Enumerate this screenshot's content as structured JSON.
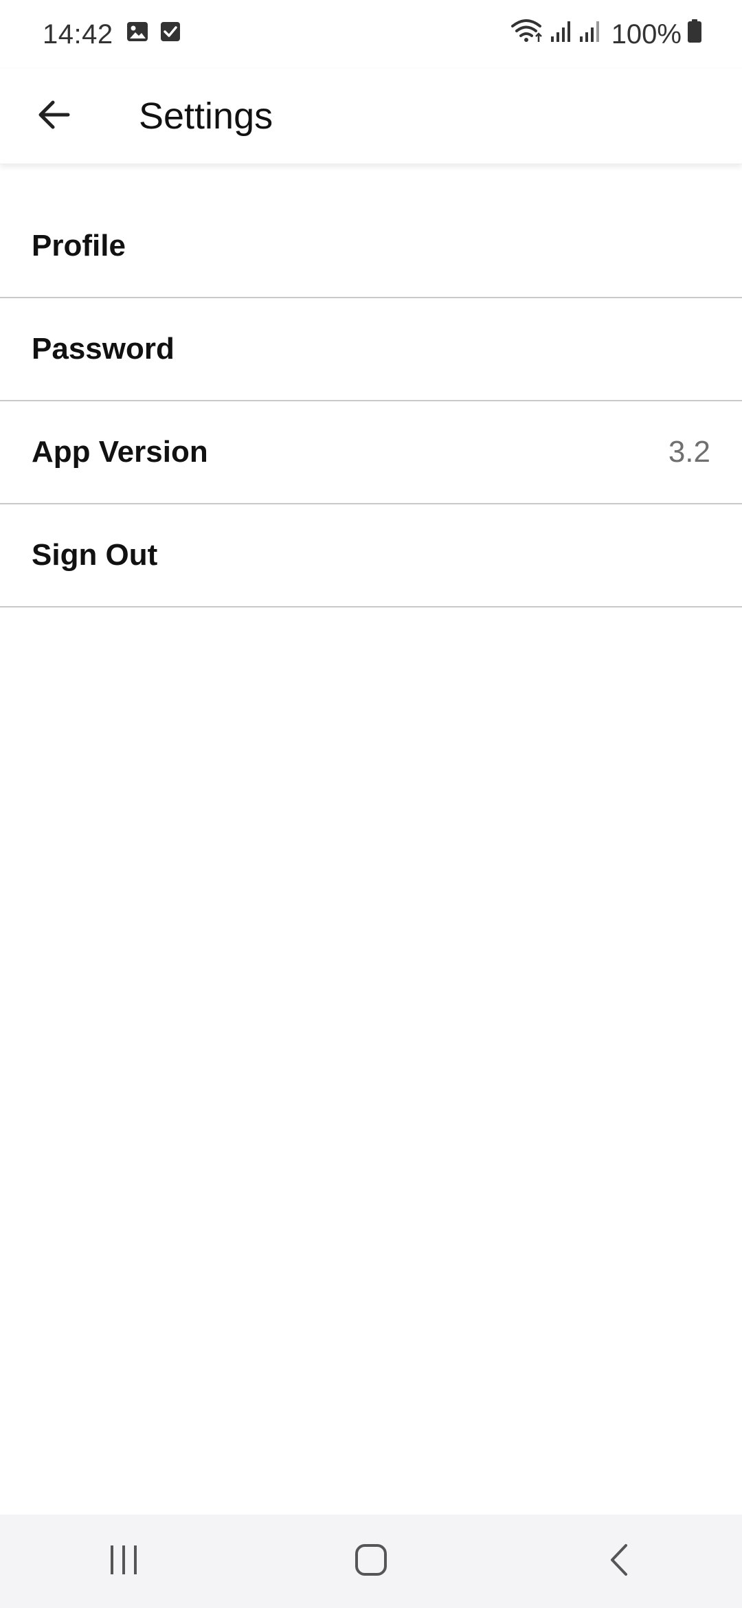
{
  "status_bar": {
    "time": "14:42",
    "left_icons": [
      "image-notification-icon",
      "checkbox-notification-icon"
    ],
    "right_icons": [
      "wifi-icon",
      "signal-icon",
      "signal-icon",
      "battery-icon"
    ],
    "battery": "100%"
  },
  "app_bar": {
    "back_icon": "arrow-left-icon",
    "title": "Settings"
  },
  "settings": {
    "items": [
      {
        "label": "Profile",
        "value": ""
      },
      {
        "label": "Password",
        "value": ""
      },
      {
        "label": "App Version",
        "value": "3.2"
      },
      {
        "label": "Sign Out",
        "value": ""
      }
    ]
  },
  "nav_bar": {
    "buttons": [
      "recent-apps-icon",
      "home-icon",
      "back-icon"
    ]
  },
  "colors": {
    "divider": "#c9c9c9",
    "nav_background": "#f4f4f6",
    "secondary_text": "#6f6f6f"
  }
}
